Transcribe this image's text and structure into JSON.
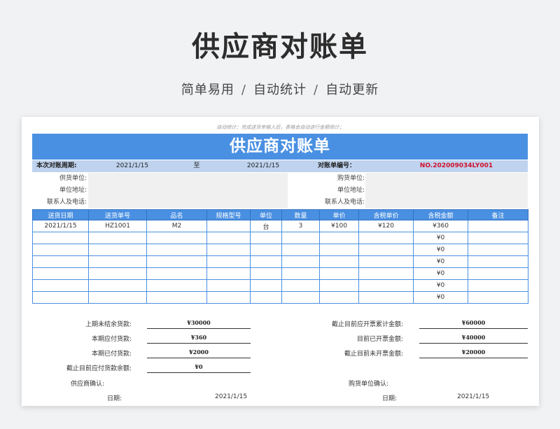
{
  "page": {
    "title": "供应商对账单",
    "subtitle_parts": [
      "简单易用",
      "自动统计",
      "自动更新"
    ],
    "separator": "/"
  },
  "sheet": {
    "note": "自动统计：完成送货单输入后，表格会自动进行金额统计；",
    "title": "供应商对账单",
    "period": {
      "label": "本次对账周期:",
      "start": "2021/1/15",
      "to": "至",
      "end": "2021/1/15",
      "statement_no_label": "对账单编号：",
      "statement_no": "NO.202009034LY001"
    },
    "info": {
      "supplier_label": "供货单位:",
      "supplier_addr_label": "单位地址:",
      "supplier_contact_label": "联系人及电话:",
      "buyer_label": "购货单位:",
      "buyer_addr_label": "单位地址:",
      "buyer_contact_label": "联系人及电话:"
    },
    "table": {
      "headers": [
        "送货日期",
        "送货单号",
        "品名",
        "规格型号",
        "单位",
        "数量",
        "单价",
        "含税单价",
        "含税金额",
        "备注"
      ],
      "rows": [
        [
          "2021/1/15",
          "HZ1001",
          "M2",
          "",
          "台",
          "3",
          "¥100",
          "¥120",
          "¥360",
          ""
        ],
        [
          "",
          "",
          "",
          "",
          "",
          "",
          "",
          "",
          "¥0",
          ""
        ],
        [
          "",
          "",
          "",
          "",
          "",
          "",
          "",
          "",
          "¥0",
          ""
        ],
        [
          "",
          "",
          "",
          "",
          "",
          "",
          "",
          "",
          "¥0",
          ""
        ],
        [
          "",
          "",
          "",
          "",
          "",
          "",
          "",
          "",
          "¥0",
          ""
        ],
        [
          "",
          "",
          "",
          "",
          "",
          "",
          "",
          "",
          "¥0",
          ""
        ],
        [
          "",
          "",
          "",
          "",
          "",
          "",
          "",
          "",
          "¥0",
          ""
        ]
      ]
    },
    "summary_left": [
      {
        "label": "上期未结余货款:",
        "value": "¥30000"
      },
      {
        "label": "本期应付货款:",
        "value": "¥360"
      },
      {
        "label": "本期已付货款:",
        "value": "¥2000"
      },
      {
        "label": "截止目前应付货款余额:",
        "value": "¥0"
      }
    ],
    "summary_right": [
      {
        "label": "截止目前应开票累计金额:",
        "value": "¥60000"
      },
      {
        "label": "目前已开票金额:",
        "value": "¥40000"
      },
      {
        "label": "截止目前未开票金额:",
        "value": "¥20000"
      }
    ],
    "confirm": {
      "supplier": "供应商确认:",
      "buyer": "购货单位确认:",
      "date_label": "日期:",
      "date_left": "2021/1/15",
      "date_right": "2021/1/15"
    }
  }
}
